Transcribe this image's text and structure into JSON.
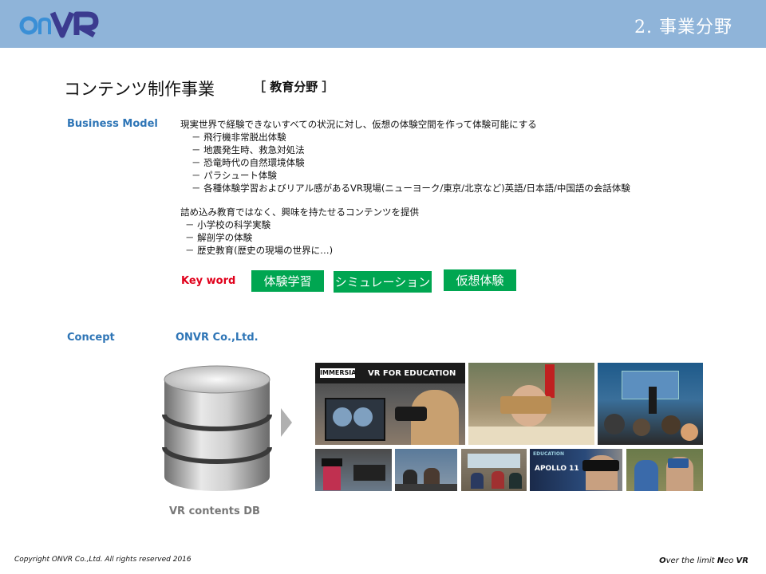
{
  "header": {
    "logo_text": "ONVR",
    "section_title": "2. 事業分野"
  },
  "title": {
    "main": "コンテンツ制作事業",
    "sub": "［ 教育分野 ］"
  },
  "business_model": {
    "label": "Business Model",
    "intro": "現実世界で経験できないすべての状況に対し、仮想の体験空間を作って体験可能にする",
    "items": [
      "－ 飛行機非常脱出体験",
      "－ 地震発生時、救急対処法",
      "－ 恐竜時代の自然環境体験",
      "－ パラシュート体験",
      "－ 各種体験学習およびリアル感があるVR現場(ニューヨーク/東京/北京など)英語/日本語/中国語の会話体験"
    ],
    "intro2": "詰め込み教育ではなく、興味を持たせるコンテンツを提供",
    "items2": [
      "－ 小学校の科学実験",
      "－ 解剖学の体験",
      "－  歴史教育(歴史の現場の世界に…)"
    ]
  },
  "keyword": {
    "label": "Key word",
    "tags": [
      "体験学習",
      "シミュレーション",
      "仮想体験"
    ],
    "tag_color": "#00a651"
  },
  "concept": {
    "label": "Concept",
    "company": "ONVR Co.,Ltd.",
    "db_label": "VR contents DB"
  },
  "photos": {
    "banner_brand": "IMMERSIA",
    "banner_title": "VR FOR EDUCATION",
    "apollo_text": "APOLLO 11",
    "education_text": "EDUCATION"
  },
  "footer": {
    "copyright": "Copyright  ONVR Co.,Ltd. All rights reserved 2016",
    "tagline_parts": [
      "O",
      "ver the limit ",
      "N",
      "eo ",
      "VR"
    ]
  },
  "colors": {
    "header_bg": "#8fb4d9",
    "label_blue": "#2e75b6",
    "label_red": "#e0001b"
  }
}
